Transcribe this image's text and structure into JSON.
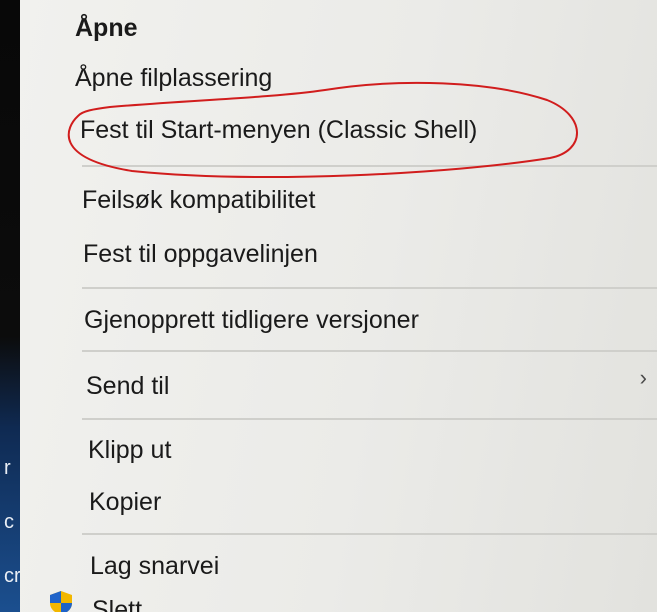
{
  "left_strip": {
    "chars": [
      "r",
      "c",
      "cr"
    ]
  },
  "menu": {
    "items": [
      {
        "id": "open",
        "label": "Åpne",
        "bold": true
      },
      {
        "id": "open-location",
        "label": "Åpne filplassering"
      },
      {
        "id": "pin-start",
        "label": "Fest til Start-menyen (Classic Shell)"
      },
      {
        "id": "troubleshoot",
        "label": "Feilsøk kompatibilitet"
      },
      {
        "id": "pin-taskbar",
        "label": "Fest til oppgavelinjen"
      },
      {
        "id": "restore",
        "label": "Gjenopprett tidligere versjoner"
      },
      {
        "id": "send-to",
        "label": "Send til",
        "submenu": true
      },
      {
        "id": "cut",
        "label": "Klipp ut"
      },
      {
        "id": "copy",
        "label": "Kopier"
      },
      {
        "id": "shortcut",
        "label": "Lag snarvei"
      },
      {
        "id": "delete",
        "label": "Slett",
        "icon": "shield-icon"
      }
    ],
    "submenu_glyph": "›"
  },
  "annotation": {
    "color": "#d11d1d",
    "target": "pin-start"
  }
}
